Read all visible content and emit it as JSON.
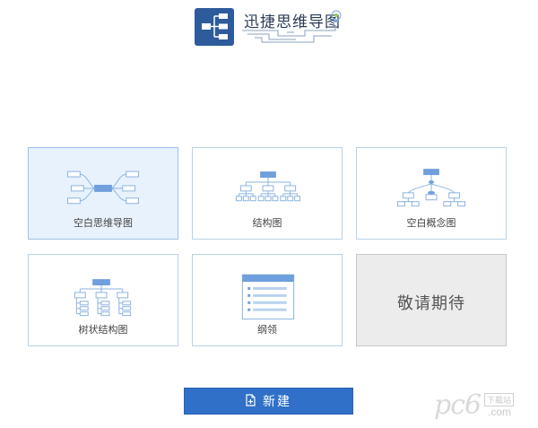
{
  "header": {
    "app_title": "迅捷思维导图"
  },
  "templates": [
    {
      "label": "空白思维导图"
    },
    {
      "label": "结构图"
    },
    {
      "label": "空白概念图"
    },
    {
      "label": "树状结构图"
    },
    {
      "label": "纲领"
    },
    {
      "label": "敬请期待"
    }
  ],
  "actions": {
    "new_label": "新建"
  },
  "watermark": {
    "brand": "pc6",
    "sub": "下载站",
    "domain": ".com"
  },
  "colors": {
    "brand_blue": "#2d5b9c",
    "accent": "#3070c8",
    "card_border": "#b9d2ea",
    "selected_bg": "#e8f2fd"
  }
}
